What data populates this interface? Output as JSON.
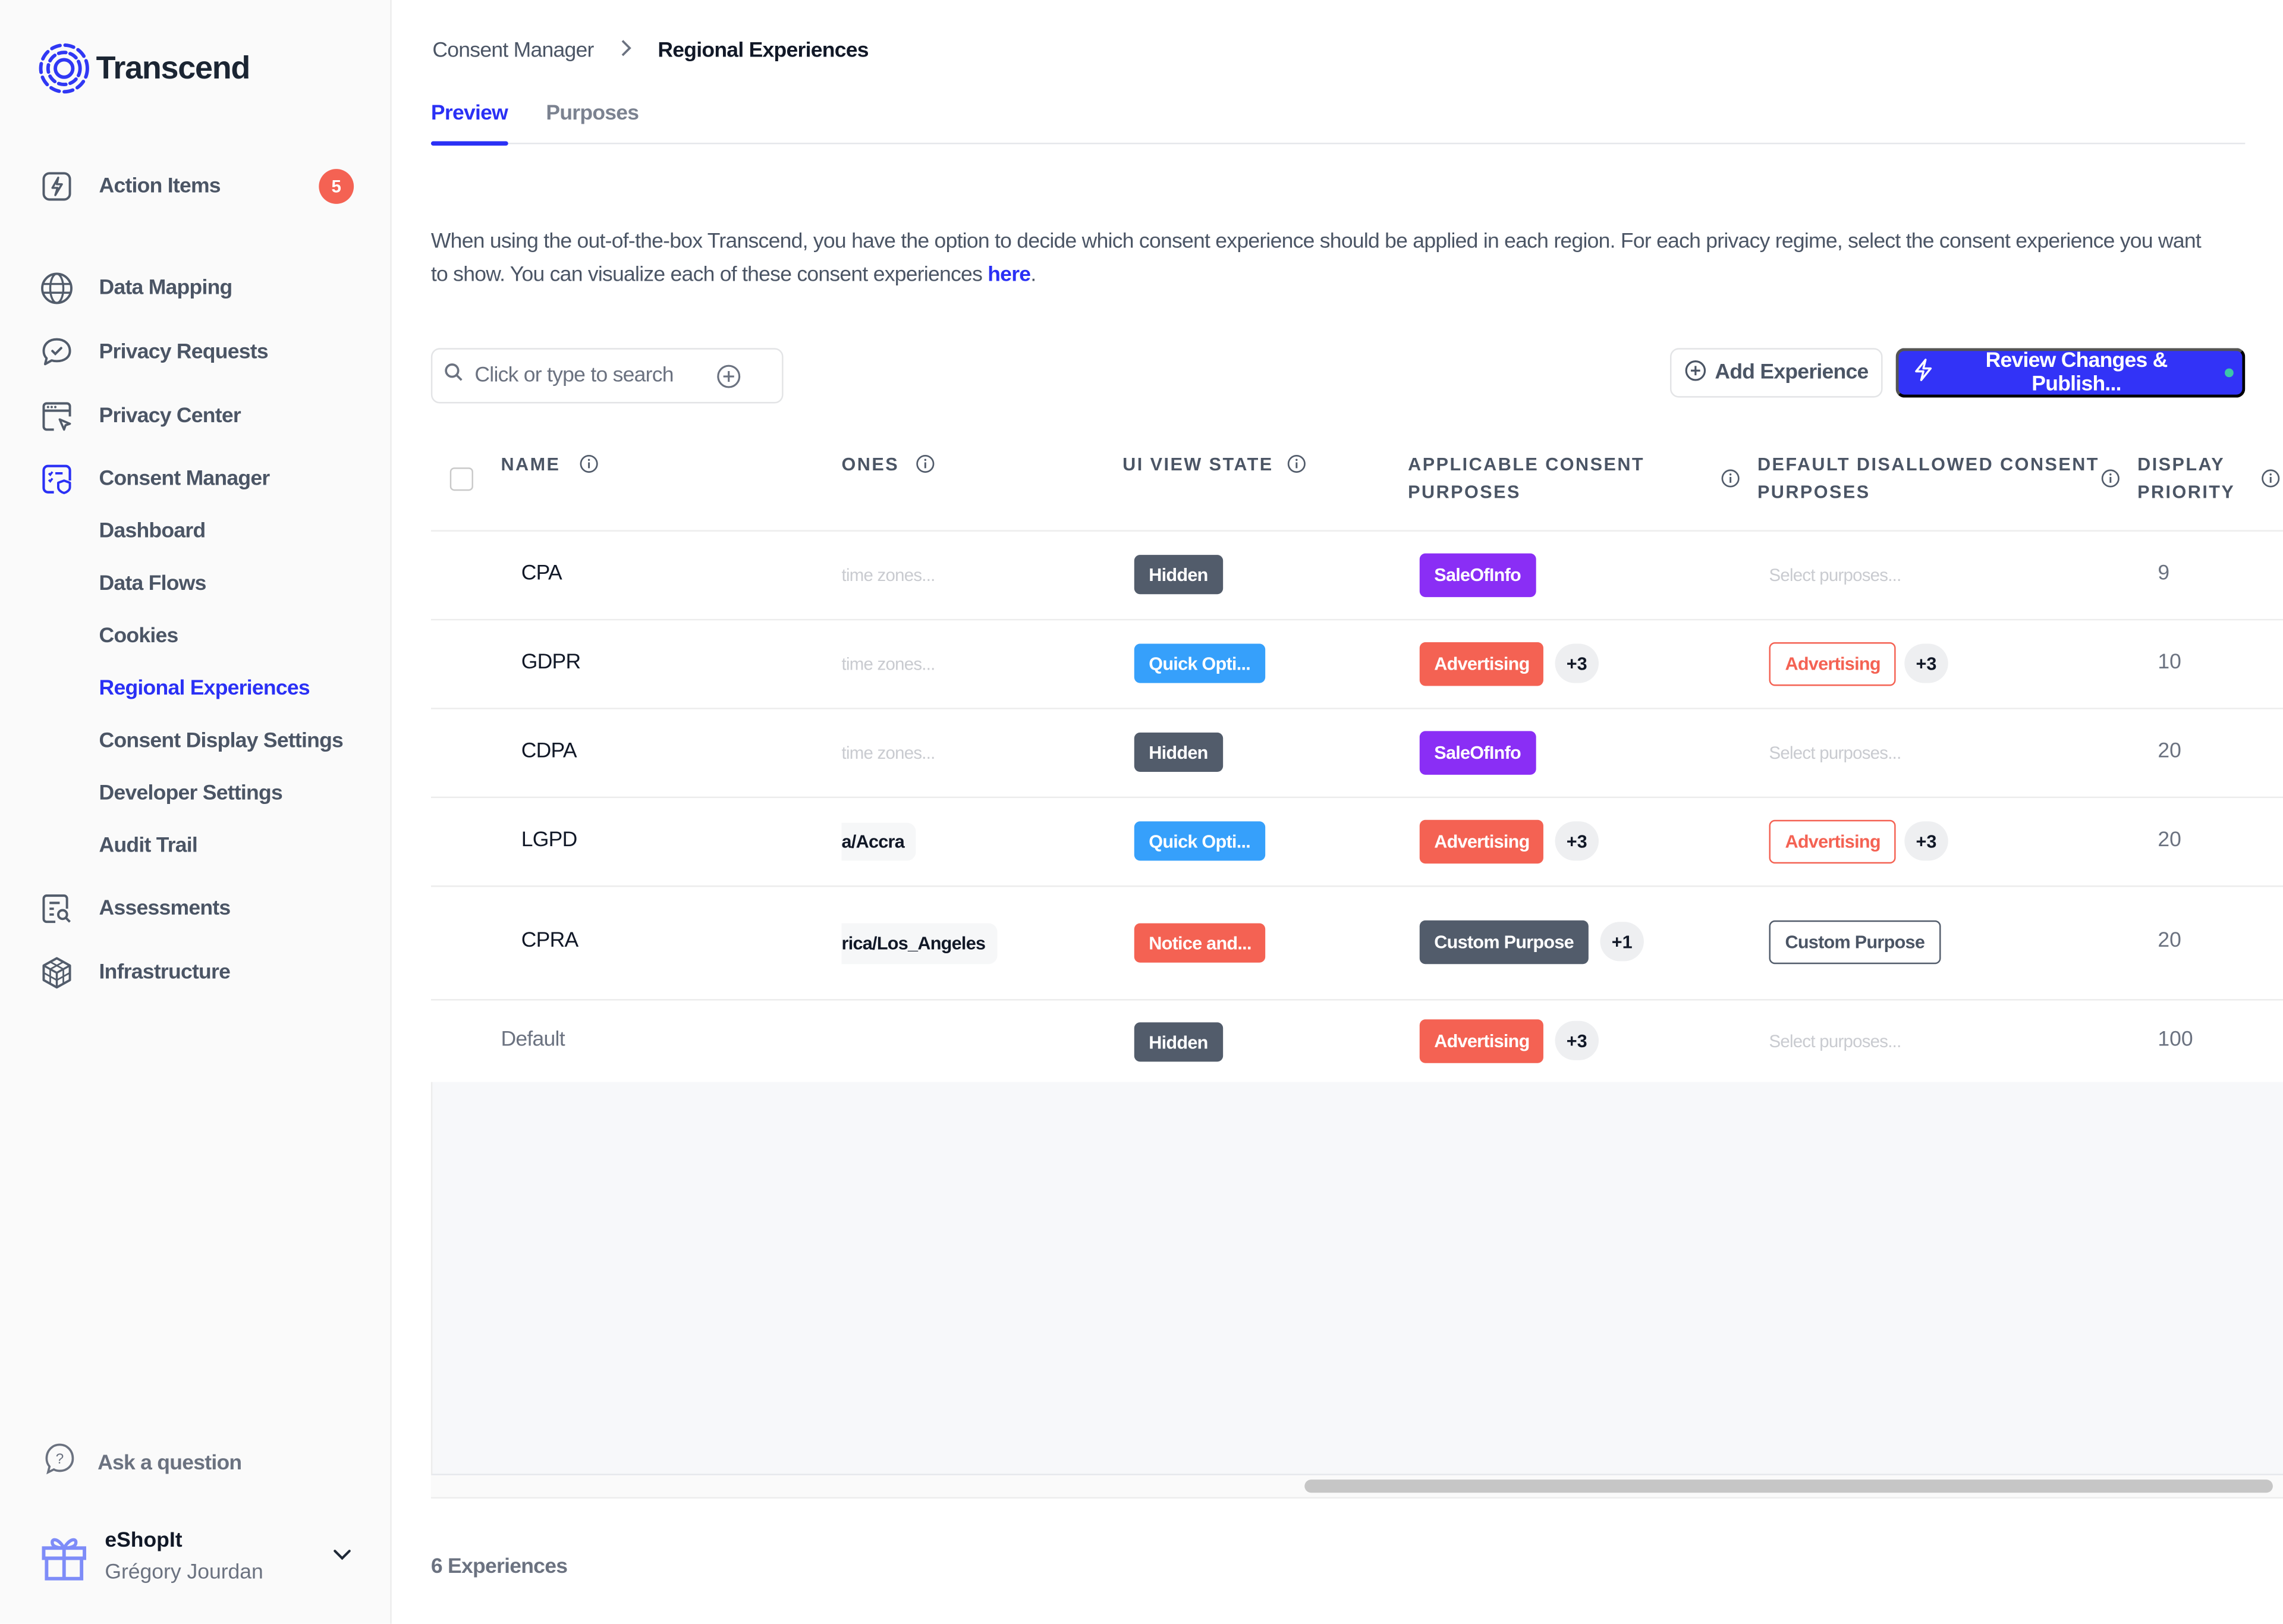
{
  "app": {
    "brand": "Transcend",
    "accent": "#2a30f5"
  },
  "sidebar": {
    "action_items": {
      "label": "Action Items",
      "badge": "5"
    },
    "items": [
      {
        "label": "Data Mapping",
        "icon": "globe-icon"
      },
      {
        "label": "Privacy Requests",
        "icon": "chat-check-icon"
      },
      {
        "label": "Privacy Center",
        "icon": "browser-cursor-icon"
      },
      {
        "label": "Consent Manager",
        "icon": "consent-shield-icon",
        "active": true
      },
      {
        "label": "Assessments",
        "icon": "document-search-icon"
      },
      {
        "label": "Infrastructure",
        "icon": "cubes-icon"
      }
    ],
    "consent_sub_items": [
      {
        "label": "Dashboard"
      },
      {
        "label": "Data Flows"
      },
      {
        "label": "Cookies"
      },
      {
        "label": "Regional Experiences",
        "active": true
      },
      {
        "label": "Consent Display Settings"
      },
      {
        "label": "Developer Settings"
      },
      {
        "label": "Audit Trail"
      }
    ],
    "ask": "Ask a question",
    "org": {
      "name": "eShopIt",
      "user": "Grégory Jourdan"
    }
  },
  "breadcrumb": {
    "parent": "Consent Manager",
    "current": "Regional Experiences"
  },
  "tabs": [
    {
      "label": "Preview",
      "active": true
    },
    {
      "label": "Purposes",
      "active": false
    }
  ],
  "description": {
    "text": "When using the out-of-the-box Transcend, you have the option to decide which consent experience should be applied in each region. For each privacy regime, select the consent experience you want to show. You can visualize each of these consent experiences ",
    "link": "here",
    "end": "."
  },
  "toolbar": {
    "search_placeholder": "Click or type to search",
    "add_label": "Add Experience",
    "publish_label": "Review Changes & Publish..."
  },
  "table": {
    "headers": {
      "name": "NAME",
      "zones": "ONES",
      "ui_view_state": "UI VIEW STATE",
      "applicable_1": "APPLICABLE CONSENT",
      "applicable_2": "PURPOSES",
      "disallowed_1": "DEFAULT DISALLOWED CONSENT",
      "disallowed_2": "PURPOSES",
      "priority_1": "DISPLAY",
      "priority_2": "PRIORITY"
    },
    "rows": [
      {
        "name": "CPA",
        "zones": "time zones...",
        "view_state": "Hidden",
        "applicable": "SaleOfInfo",
        "applicable_more": "",
        "disallowed": "Select purposes...",
        "disallowed_more": "",
        "priority": "9"
      },
      {
        "name": "GDPR",
        "zones": "time zones...",
        "view_state": "Quick Opti...",
        "applicable": "Advertising",
        "applicable_more": "+3",
        "disallowed": "Advertising",
        "disallowed_more": "+3",
        "priority": "10"
      },
      {
        "name": "CDPA",
        "zones": "time zones...",
        "view_state": "Hidden",
        "applicable": "SaleOfInfo",
        "applicable_more": "",
        "disallowed": "Select purposes...",
        "disallowed_more": "",
        "priority": "20"
      },
      {
        "name": "LGPD",
        "zones": "a/Accra",
        "view_state": "Quick Opti...",
        "applicable": "Advertising",
        "applicable_more": "+3",
        "disallowed": "Advertising",
        "disallowed_more": "+3",
        "priority": "20"
      },
      {
        "name": "CPRA",
        "zones": "rica/Los_Angeles",
        "view_state": "Notice and...",
        "applicable": "Custom Purpose",
        "applicable_more": "+1",
        "disallowed": "Custom Purpose",
        "disallowed_more": "",
        "priority": "20"
      },
      {
        "name": "Default",
        "zones": "",
        "view_state": "Hidden",
        "applicable": "Advertising",
        "applicable_more": "+3",
        "disallowed": "Select purposes...",
        "disallowed_more": "",
        "priority": "100"
      }
    ],
    "colors": {
      "hidden": "#525c6b",
      "quick_option": "#36a0fb",
      "notice": "#f46253",
      "sale_of_info": "#8a2ef5",
      "advertising": "#f46253",
      "custom_purpose": "#525c6b"
    }
  },
  "footer": {
    "count": "6 Experiences"
  }
}
